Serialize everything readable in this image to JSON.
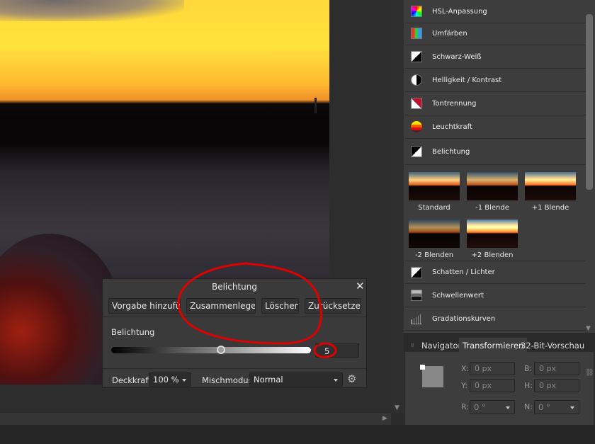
{
  "dialog": {
    "title": "Belichtung",
    "buttons": [
      "Vorgabe hinzufügen",
      "Zusammenlegen",
      "Löschen",
      "Zurücksetzen"
    ],
    "slider_label": "Belichtung",
    "slider_value": "5",
    "slider_position_percent": 55,
    "opacity_label": "Deckkraft:",
    "opacity_value": "100 %",
    "blend_label": "Mischmodus:",
    "blend_value": "Normal",
    "gear_icon": "gear-icon",
    "close_icon": "close-icon"
  },
  "adjustments": {
    "items": [
      {
        "label": "HSL-Anpassung",
        "icon": "hsl-icon"
      },
      {
        "label": "Umfärben",
        "icon": "recolor-icon"
      },
      {
        "label": "Schwarz-Weiß",
        "icon": "black-white-icon"
      },
      {
        "label": "Helligkeit / Kontrast",
        "icon": "brightness-contrast-icon"
      },
      {
        "label": "Tontrennung",
        "icon": "posterize-icon"
      },
      {
        "label": "Leuchtkraft",
        "icon": "vibrance-icon"
      },
      {
        "label": "Belichtung",
        "icon": "exposure-icon"
      }
    ],
    "presets": [
      "Standard",
      "-1 Blende",
      "+1 Blende",
      "-2 Blenden",
      "+2 Blenden"
    ],
    "items_after": [
      {
        "label": "Schatten / Lichter",
        "icon": "shadows-highlights-icon"
      },
      {
        "label": "Schwellenwert",
        "icon": "threshold-icon"
      },
      {
        "label": "Gradationskurven",
        "icon": "curves-icon"
      }
    ]
  },
  "tabs": [
    "Navigator",
    "Transformieren",
    "32-Bit-Vorschau"
  ],
  "active_tab": "Transformieren",
  "transform": {
    "x_label": "X:",
    "x": "0 px",
    "y_label": "Y:",
    "y": "0 px",
    "b_label": "B:",
    "b": "0 px",
    "h_label": "H:",
    "h": "0 px",
    "r_label": "R:",
    "r": "0 °",
    "n_label": "N:",
    "n": "0 °"
  },
  "annotation_color": "#e00000"
}
